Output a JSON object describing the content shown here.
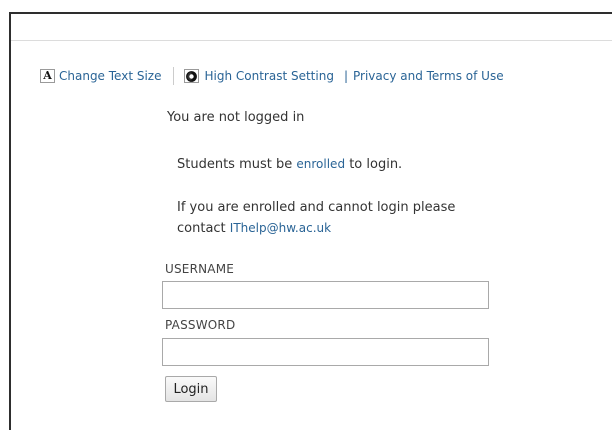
{
  "accessibility_bar": {
    "text_size_label": "Change Text Size",
    "text_size_icon": "text-size-icon",
    "contrast_label": "High Contrast Setting",
    "contrast_icon": "contrast-icon",
    "separator": "|",
    "privacy_label": "Privacy and Terms of Use"
  },
  "login": {
    "status": "You are not logged in",
    "notice_prefix": "Students must be",
    "enrolled_link": "enrolled",
    "notice_suffix": "to login.",
    "help_text": "If you are enrolled and cannot login please contact",
    "help_email": "IThelp@hw.ac.uk",
    "username_label": "USERNAME",
    "username_value": "",
    "password_label": "PASSWORD",
    "password_value": "",
    "submit_label": "Login"
  },
  "colors": {
    "link": "#2a6496",
    "text": "#333333",
    "frame": "#2e2e2e"
  }
}
